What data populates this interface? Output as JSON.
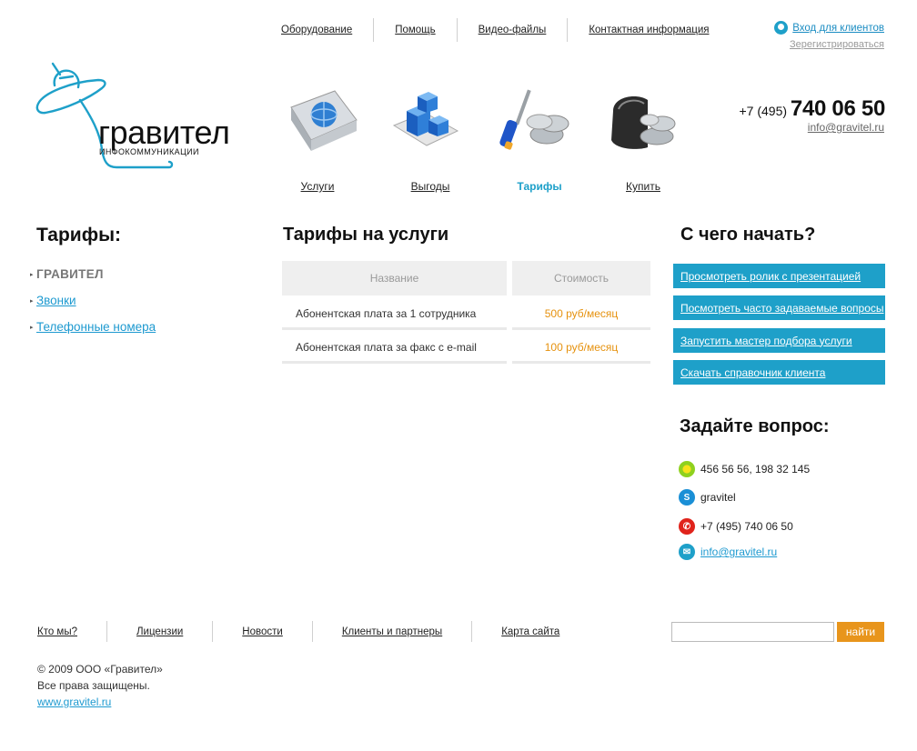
{
  "header": {
    "nav": [
      "Оборудование",
      "Помощь",
      "Видео-файлы",
      "Контактная информация"
    ],
    "login_label": "Вход для клиентов",
    "register_label": "Зерегистрироваться",
    "phone_prefix": "+7 (495)",
    "phone_main": "740 06 50",
    "email": "info@gravitel.ru"
  },
  "logo": {
    "name": "гравител",
    "subtitle": "ИНФОКОММУНИКАЦИИ"
  },
  "services": [
    {
      "label": "Услуги",
      "icon": "book-globe-icon"
    },
    {
      "label": "Выгоды",
      "icon": "blue-cubes-icon"
    },
    {
      "label": "Тарифы",
      "icon": "screwdriver-coins-icon",
      "active": true
    },
    {
      "label": "Купить",
      "icon": "wallet-coins-icon"
    }
  ],
  "left": {
    "title": "Тарифы:",
    "items": [
      "ГРАВИТЕЛ",
      "Звонки",
      "Телефонные номера"
    ]
  },
  "main": {
    "title": "Тарифы на услуги",
    "columns": [
      "Название",
      "Стоимость"
    ],
    "rows": [
      [
        "Абонентская плата за 1 сотрудника",
        "500 руб/месяц"
      ],
      [
        "Абонентская плата за факс с e-mail",
        "100 руб/месяц"
      ]
    ]
  },
  "right": {
    "start_title": "С чего начать?",
    "start_links": [
      "Просмотреть ролик с презентацией",
      "Посмотреть часто задаваемые вопросы",
      "Запустить мастер подбора услуги",
      "Скачать справочник клиента"
    ],
    "ask_title": "Задайте вопрос:",
    "icq": "456 56 56, 198 32 145",
    "skype": "gravitel",
    "phone": "+7 (495) 740 06 50",
    "email": "info@gravitel.ru"
  },
  "footer": {
    "nav": [
      "Кто мы?",
      "Лицензии",
      "Новости",
      "Клиенты и партнеры",
      "Карта сайта"
    ],
    "search_placeholder": "",
    "search_button": "найти",
    "copyright": "© 2009 ООО «Гравител»",
    "rights": "Все права защищены.",
    "site": "www.gravitel.ru"
  },
  "colors": {
    "accent_blue": "#1ea0c9",
    "price_orange": "#e6920f",
    "search_button": "#e8951c"
  }
}
